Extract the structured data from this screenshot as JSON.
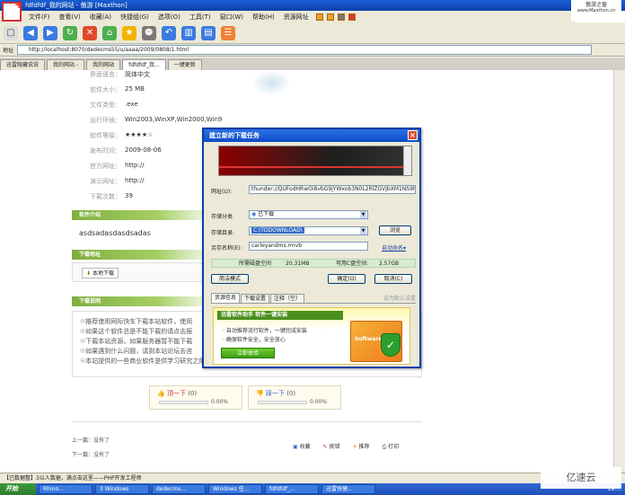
{
  "window": {
    "title": "fdfdfdf_我的网站 - 傲游 [Maxthon]"
  },
  "branding": {
    "maxthon_text": "傲游之窗",
    "maxthon_url": "www.Maxthon.cn"
  },
  "menu": [
    "文件(F)",
    "查看(V)",
    "收藏(A)",
    "快捷组(G)",
    "选项(O)",
    "工具(T)",
    "窗口(W)",
    "帮助(H)",
    "资源网址"
  ],
  "address": {
    "label": "地址",
    "url": "http://localhost:8070/dedecms55/u/aaaa/2009/0808/1.html"
  },
  "tabs": [
    {
      "label": "迅雷隐藏说说",
      "active": false
    },
    {
      "label": "我的网站 -",
      "active": false
    },
    {
      "label": "我的网站",
      "active": false
    },
    {
      "label": "fdfdfdf_我...",
      "active": true
    },
    {
      "label": "一键更新",
      "active": false
    }
  ],
  "software_info": [
    {
      "key": "界面语言：",
      "value": "简体中文"
    },
    {
      "key": "软件大小：",
      "value": "25 MB"
    },
    {
      "key": "文件类型：",
      "value": ".exe"
    },
    {
      "key": "运行环境：",
      "value": "Win2003,WinXP,Win2000,Win9"
    },
    {
      "key": "软件等级：",
      "value": "★★★★☆"
    },
    {
      "key": "发布时间：",
      "value": "2009-08-06"
    },
    {
      "key": "官方网址：",
      "value": "http://"
    },
    {
      "key": "演示网址：",
      "value": "http://"
    },
    {
      "key": "下载次数：",
      "value": "39"
    }
  ],
  "sections": {
    "intro": "软件介绍",
    "download": "下载地址",
    "notes": "下载说明"
  },
  "intro_text": "asdsadasdasdsadas",
  "download_link": "本地下载",
  "notes": [
    "☉推荐使用网际快车下载本站软件，使用",
    "☉如果这个软件总是不能下载的请点击报",
    "☉下载本站资源，如果服务器暂不能下载",
    "☉如果遇到什么问题，请到本站论坛去咨",
    "☉本站提供的一些商业软件是供学习研究之用，如用于商业用途，请购买正版。"
  ],
  "votes": [
    {
      "label": "顶一下",
      "count": "(0)",
      "percent": "0.00%",
      "fill": 0
    },
    {
      "label": "踩一下",
      "count": "(0)",
      "percent": "0.00%",
      "fill": 0
    }
  ],
  "nav": {
    "prev": "上一篇：没有了",
    "next": "下一篇：没有了"
  },
  "actions": [
    "收藏",
    "挑错",
    "推荐",
    "打印"
  ],
  "status_text": "【已数据整】3以人数据，满点击这里——PHP开发工程师",
  "taskbar": {
    "start": "开始",
    "items": [
      "Rhino...",
      "3 Windows",
      "dedecms...",
      "Windows 任...",
      "fdfdfdf_...",
      "迅雷快捷..."
    ],
    "clock": "19:..."
  },
  "watermark": "亿速云",
  "dialog": {
    "title": "建立新的下载任务",
    "url_label": "网址(U):",
    "url_value": "thunder://QUFodHRwOi8vbG9jYWxob3N0L2RlZGVjbXM1NS9h",
    "category_label": "存储分类",
    "category_value": "已下载",
    "dir_label": "存储目录:",
    "dir_value": "C:\\TDDOWNLOAD\\",
    "browse": "浏览",
    "saveas_label": "另存名称(E):",
    "saveas_value": "carleyandms.rmvb",
    "auto_rename": "自动命名",
    "space_label": "所需磁盘空间",
    "space_value": "20.31MB",
    "free_label": "可用C盘空间:",
    "free_value": "2.57GB",
    "simple_mode": "简洁模式",
    "ok": "确定(O)",
    "cancel": "取消(C)",
    "tabs": [
      "资源信息",
      "下载设置",
      "注释（空）"
    ],
    "default_link": "设为默认设置",
    "promo_title": "迅雷软件助手  软件一键安装",
    "promo_lines": [
      "· 自动推荐流行软件，一键完成安装",
      "· 确保软件安全，安全放心"
    ],
    "promo_button": "立即体验",
    "promo_box_label": "Software"
  }
}
